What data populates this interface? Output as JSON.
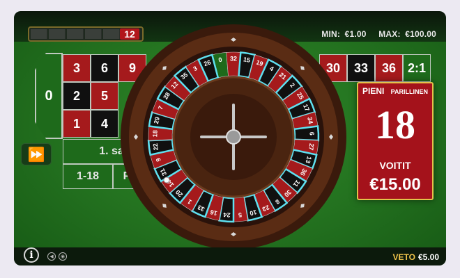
{
  "history": {
    "last_number": "12"
  },
  "limits": {
    "min_label": "MIN:",
    "min_value": "€1.00",
    "max_label": "MAX:",
    "max_value": "€100.00"
  },
  "table": {
    "zero": "0",
    "rows": [
      [
        {
          "n": "3",
          "c": "red"
        },
        {
          "n": "6",
          "c": "black"
        },
        {
          "n": "9",
          "c": "red"
        }
      ],
      [
        {
          "n": "2",
          "c": "black"
        },
        {
          "n": "5",
          "c": "red"
        }
      ],
      [
        {
          "n": "1",
          "c": "red"
        },
        {
          "n": "4",
          "c": "black"
        }
      ]
    ],
    "right_numbers": [
      [
        {
          "n": "30",
          "c": "red"
        },
        {
          "n": "33",
          "c": "black"
        },
        {
          "n": "36",
          "c": "red"
        },
        {
          "n": "2:1",
          "c": "green"
        }
      ]
    ],
    "dozen_label": "1. sa",
    "low_label": "1-18",
    "partial_label": "P"
  },
  "wheel": {
    "numbers": [
      "0",
      "32",
      "15",
      "19",
      "4",
      "21",
      "2",
      "25",
      "17",
      "34",
      "6",
      "27",
      "13",
      "36",
      "11",
      "30",
      "8",
      "23",
      "10",
      "5",
      "24",
      "16",
      "33",
      "1",
      "20",
      "14",
      "31",
      "9",
      "22",
      "18",
      "29",
      "7",
      "28",
      "12",
      "35",
      "3",
      "26"
    ],
    "highlighted": [
      "15",
      "4",
      "2",
      "17",
      "6",
      "13",
      "11",
      "8",
      "10",
      "24",
      "33",
      "20",
      "31",
      "22",
      "29",
      "28",
      "35",
      "26"
    ]
  },
  "result": {
    "type": "PIENI",
    "parity": "PARILLINEN",
    "number": "18",
    "win_label": "VOITIT",
    "amount": "€15.00"
  },
  "footer": {
    "info": "i",
    "bet_label": "VETO",
    "bet_value": "€5.00"
  },
  "colors": {
    "red": "#a51a1c",
    "black": "#101010",
    "green": "#1e6a1b",
    "gold": "#e4c24a",
    "highlight": "#5fe0f0"
  }
}
